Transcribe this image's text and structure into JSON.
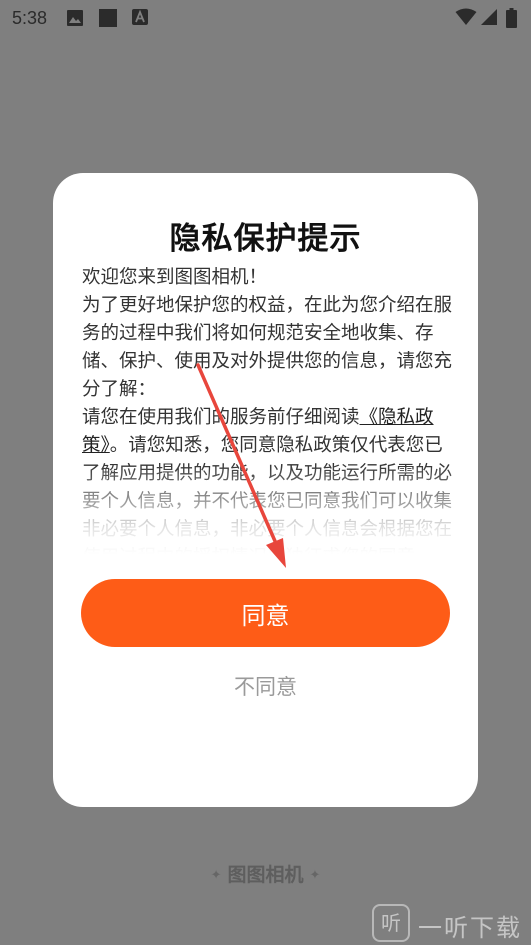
{
  "status_bar": {
    "time": "5:38",
    "icons": [
      "image-icon",
      "square-icon",
      "font-icon",
      "wifi-icon",
      "signal-icon",
      "battery-icon"
    ]
  },
  "dialog": {
    "title": "隐私保护提示",
    "paragraphs": [
      "欢迎您来到图图相机！",
      "为了更好地保护您的权益，在此为您介绍在服务的过程中我们将如何规范安全地收集、存储、保护、使用及对外提供您的信息，请您充分了解：",
      "请您在使用我们的服务前仔细阅读"
    ],
    "policy_link": "《隐私政策》",
    "after_link": "。请您知悉，您同意隐私政策仅代表您已了解应用提供的功能，以及功能运行所需的必要个人信息，并不代表您已同意我们可以收集非必要个人信息，非必要个人信息会根据您在使用过程中的授权情况单独征求您的同意。",
    "agree_label": "同意",
    "disagree_label": "不同意"
  },
  "brand": {
    "name": "图图相机"
  },
  "watermark": {
    "text": "一听下载",
    "box_char": "听"
  },
  "colors": {
    "accent": "#fe5c17",
    "arrow": "#e8463c",
    "overlay": "#7f7f7f"
  }
}
